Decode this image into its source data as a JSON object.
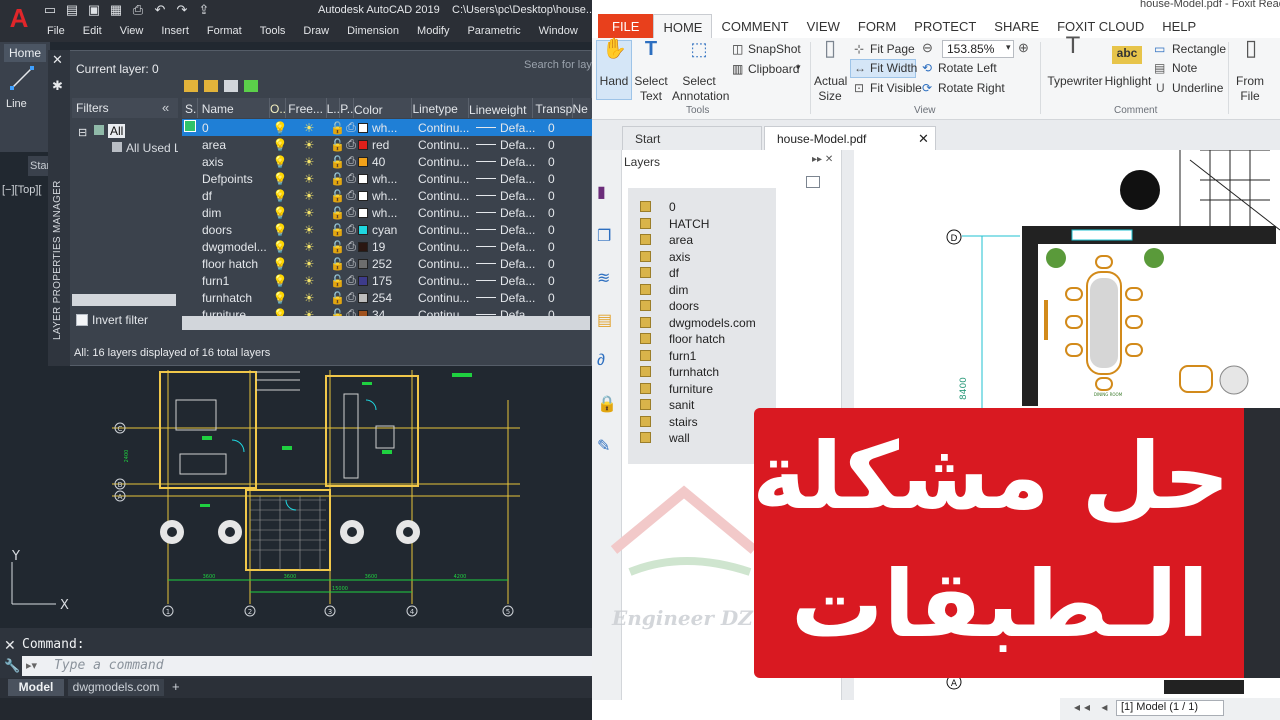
{
  "autocad": {
    "app_title": "Autodesk AutoCAD 2019",
    "file_path": "C:\\Users\\pc\\Desktop\\house...",
    "logo": "A",
    "menu": [
      "File",
      "Edit",
      "View",
      "Insert",
      "Format",
      "Tools",
      "Draw",
      "Dimension",
      "Modify",
      "Parametric",
      "Window"
    ],
    "ribbon_tab": "Home",
    "line_tool": "Line",
    "viewport_label": "[−][Top][",
    "start_tab": "Start",
    "layer_manager": {
      "side_title": "LAYER PROPERTIES MANAGER",
      "current_layer": "Current layer: 0",
      "search_placeholder": "Search for layer",
      "filters_header": "Filters",
      "filter_all": "All",
      "filter_used": "All Used Layers",
      "invert_filter": "Invert filter",
      "status": "All: 16 layers displayed of 16 total layers",
      "columns": [
        "S..",
        "Name",
        "O..",
        "Free...",
        "L..",
        "P..",
        "Color",
        "Linetype",
        "Lineweight",
        "Transp...",
        "Ne"
      ],
      "rows": [
        {
          "name": "0",
          "color_name": "wh...",
          "swatch": "#ffffff",
          "linetype": "Continu...",
          "lineweight": "Defa...",
          "transparency": "0",
          "selected": true
        },
        {
          "name": "area",
          "color_name": "red",
          "swatch": "#e0201a",
          "linetype": "Continu...",
          "lineweight": "Defa...",
          "transparency": "0"
        },
        {
          "name": "axis",
          "color_name": "40",
          "swatch": "#f2a21a",
          "linetype": "Continu...",
          "lineweight": "Defa...",
          "transparency": "0"
        },
        {
          "name": "Defpoints",
          "color_name": "wh...",
          "swatch": "#ffffff",
          "linetype": "Continu...",
          "lineweight": "Defa...",
          "transparency": "0"
        },
        {
          "name": "df",
          "color_name": "wh...",
          "swatch": "#ffffff",
          "linetype": "Continu...",
          "lineweight": "Defa...",
          "transparency": "0"
        },
        {
          "name": "dim",
          "color_name": "wh...",
          "swatch": "#ffffff",
          "linetype": "Continu...",
          "lineweight": "Defa...",
          "transparency": "0"
        },
        {
          "name": "doors",
          "color_name": "cyan",
          "swatch": "#1fd7e0",
          "linetype": "Continu...",
          "lineweight": "Defa...",
          "transparency": "0"
        },
        {
          "name": "dwgmodel...",
          "color_name": "19",
          "swatch": "#2a1712",
          "linetype": "Continu...",
          "lineweight": "Defa...",
          "transparency": "0"
        },
        {
          "name": "floor hatch",
          "color_name": "252",
          "swatch": "#6d6d6d",
          "linetype": "Continu...",
          "lineweight": "Defa...",
          "transparency": "0"
        },
        {
          "name": "furn1",
          "color_name": "175",
          "swatch": "#3d3b8a",
          "linetype": "Continu...",
          "lineweight": "Defa...",
          "transparency": "0"
        },
        {
          "name": "furnhatch",
          "color_name": "254",
          "swatch": "#bdbdbd",
          "linetype": "Continu...",
          "lineweight": "Defa...",
          "transparency": "0"
        },
        {
          "name": "furniture",
          "color_name": "34",
          "swatch": "#a0521e",
          "linetype": "Continu...",
          "lineweight": "Defa...",
          "transparency": "0"
        }
      ]
    },
    "drawing": {
      "axis_letters": [
        "C",
        "B",
        "A"
      ],
      "axis_numbers": [
        "1",
        "2",
        "3",
        "4",
        "5"
      ],
      "dims": [
        "3600",
        "3600",
        "3600",
        "4200"
      ],
      "total_dim": "15000",
      "side_dim": "2400",
      "ucs_y": "Y",
      "ucs_x": "X"
    },
    "command_label": "Command:",
    "command_placeholder": "Type a command",
    "tabs": [
      "Model",
      "dwgmodels.com"
    ],
    "tab_add": "+"
  },
  "foxit": {
    "window_title": "house-Model.pdf - Foxit Reader",
    "menu": [
      "FILE",
      "HOME",
      "COMMENT",
      "VIEW",
      "FORM",
      "PROTECT",
      "SHARE",
      "FOXIT CLOUD",
      "HELP"
    ],
    "ribbon": {
      "hand": "Hand",
      "select_text": "Select Text",
      "select_annotation": "Select Annotation",
      "snapshot": "SnapShot",
      "clipboard": "Clipboard",
      "tools_group": "Tools",
      "actual_size": "Actual Size",
      "fit_page": "Fit Page",
      "fit_width": "Fit Width",
      "fit_visible": "Fit Visible",
      "zoom_value": "153.85%",
      "rotate_left": "Rotate Left",
      "rotate_right": "Rotate Right",
      "view_group": "View",
      "typewriter": "Typewriter",
      "highlight": "Highlight",
      "rectangle": "Rectangle",
      "note": "Note",
      "underline": "Underline",
      "comment_group": "Comment",
      "from_file": "From File"
    },
    "tabs": {
      "start": "Start",
      "document": "house-Model.pdf"
    },
    "layers_title": "Layers",
    "layers": [
      "0",
      "HATCH",
      "area",
      "axis",
      "df",
      "dim",
      "doors",
      "dwgmodels.com",
      "floor hatch",
      "furn1",
      "furnhatch",
      "furniture",
      "sanit",
      "stairs",
      "wall"
    ],
    "page_nav": "[1] Model (1 / 1)",
    "plan_labels": {
      "axis_d": "D",
      "axis_a": "A",
      "dining": "DINING ROOM",
      "dim": "8400"
    }
  },
  "banner": {
    "line1": "حل مشكلة",
    "line2": "الـطبقات",
    "bg_color": "#d91921"
  },
  "watermark": "Engineer DZ"
}
